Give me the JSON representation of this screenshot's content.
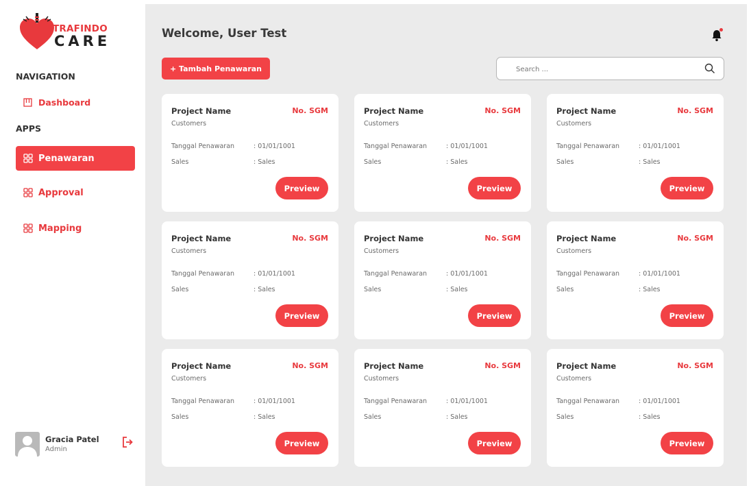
{
  "brand": {
    "top": "TRAFINDO",
    "bottom": "CARE"
  },
  "nav": {
    "heading": "NAVIGATION",
    "dashboard": "Dashboard",
    "apps_heading": "APPS",
    "items": [
      {
        "label": "Penawaran",
        "active": true
      },
      {
        "label": "Approval",
        "active": false
      },
      {
        "label": "Mapping",
        "active": false
      }
    ]
  },
  "user": {
    "name": "Gracia Patel",
    "role": "Admin"
  },
  "header": {
    "welcome": "Welcome, User Test",
    "add_button": "+ Tambah Penawaran",
    "search_placeholder": "Search ..."
  },
  "card_labels": {
    "tanggal": "Tanggal Penawaran",
    "sales": "Sales"
  },
  "cards": [
    {
      "project": "Project Name",
      "no": "No. SGM",
      "customer": "Customers",
      "tanggal": ": 01/01/1001",
      "sales": ": Sales",
      "button": "Preview"
    },
    {
      "project": "Project Name",
      "no": "No. SGM",
      "customer": "Customers",
      "tanggal": ": 01/01/1001",
      "sales": ": Sales",
      "button": "Preview"
    },
    {
      "project": "Project Name",
      "no": "No. SGM",
      "customer": "Customers",
      "tanggal": ": 01/01/1001",
      "sales": ": Sales",
      "button": "Preview"
    },
    {
      "project": "Project Name",
      "no": "No. SGM",
      "customer": "Customers",
      "tanggal": ": 01/01/1001",
      "sales": ": Sales",
      "button": "Preview"
    },
    {
      "project": "Project Name",
      "no": "No. SGM",
      "customer": "Customers",
      "tanggal": ": 01/01/1001",
      "sales": ": Sales",
      "button": "Preview"
    },
    {
      "project": "Project Name",
      "no": "No. SGM",
      "customer": "Customers",
      "tanggal": ": 01/01/1001",
      "sales": ": Sales",
      "button": "Preview"
    },
    {
      "project": "Project Name",
      "no": "No. SGM",
      "customer": "Customers",
      "tanggal": ": 01/01/1001",
      "sales": ": Sales",
      "button": "Preview"
    },
    {
      "project": "Project Name",
      "no": "No. SGM",
      "customer": "Customers",
      "tanggal": ": 01/01/1001",
      "sales": ": Sales",
      "button": "Preview"
    },
    {
      "project": "Project Name",
      "no": "No. SGM",
      "customer": "Customers",
      "tanggal": ": 01/01/1001",
      "sales": ": Sales",
      "button": "Preview"
    }
  ],
  "colors": {
    "accent": "#f24246",
    "background": "#ebebeb",
    "card": "#ffffff"
  },
  "icons": {
    "dashboard": "dashboard-icon",
    "nav_item": "grid-icon",
    "notification": "bell-icon",
    "search": "search-icon",
    "logout": "logout-icon"
  }
}
